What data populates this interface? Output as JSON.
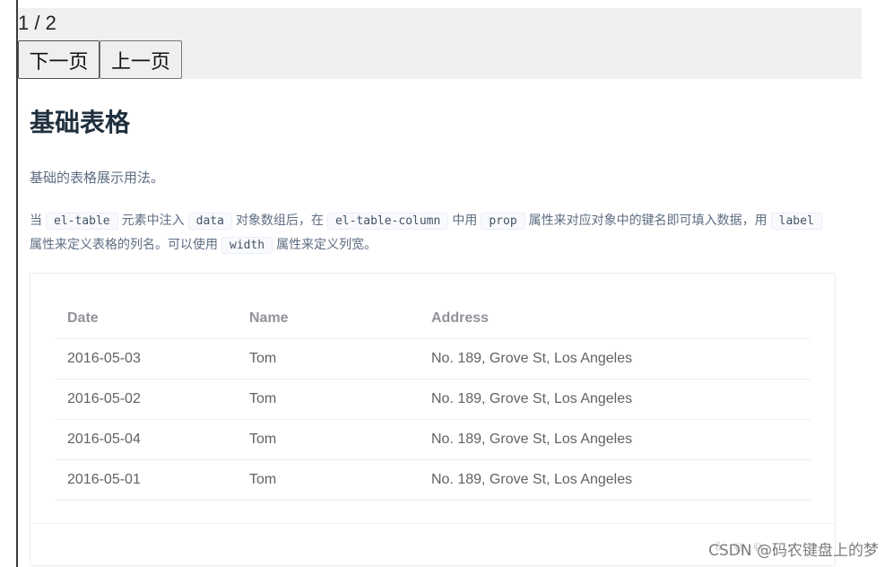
{
  "pager": {
    "indicator": "1 / 2",
    "next_label": "下一页",
    "prev_label": "上一页"
  },
  "section": {
    "title": "基础表格",
    "description": "基础的表格展示用法。",
    "para": {
      "t1": "当",
      "c1": "el-table",
      "t2": "元素中注入",
      "c2": "data",
      "t3": "对象数组后，在",
      "c3": "el-table-column",
      "t4": "中用",
      "c4": "prop",
      "t5": "属性来对应对象中的键名即可填入数据，用",
      "c5": "label",
      "t6": "属性来定义表格的列名。可以使用",
      "c6": "width",
      "t7": "属性来定义列宽。"
    }
  },
  "table": {
    "headers": [
      "Date",
      "Name",
      "Address"
    ],
    "rows": [
      [
        "2016-05-03",
        "Tom",
        "No. 189, Grove St, Los Angeles"
      ],
      [
        "2016-05-02",
        "Tom",
        "No. 189, Grove St, Los Angeles"
      ],
      [
        "2016-05-04",
        "Tom",
        "No. 189, Grove St, Los Angeles"
      ],
      [
        "2016-05-01",
        "Tom",
        "No. 189, Grove St, Los Angeles"
      ]
    ]
  },
  "watermark": {
    "text": "CSDN @码农键盘上的梦"
  }
}
